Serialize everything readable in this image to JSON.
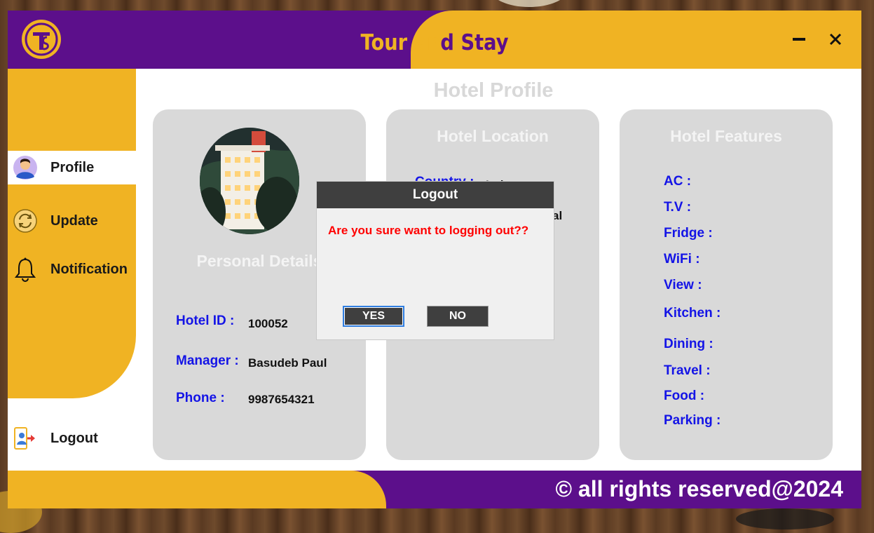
{
  "app": {
    "title_part1": "Tour an",
    "title_part2": "d Stay",
    "footer": "© all rights reserved@2024"
  },
  "window_controls": {
    "minimize": "–",
    "close": "✕"
  },
  "sidebar": {
    "items": [
      {
        "label": "Profile",
        "icon": "user-avatar-icon",
        "active": true
      },
      {
        "label": "Update",
        "icon": "refresh-icon"
      },
      {
        "label": "Notification",
        "icon": "bell-icon"
      }
    ],
    "logout": {
      "label": "Logout",
      "icon": "logout-icon"
    }
  },
  "main": {
    "page_title": "Hotel Profile",
    "personal": {
      "title": "Personal Details",
      "hotel_id_label": "Hotel ID :",
      "hotel_id": "100052",
      "manager_label": "Manager :",
      "manager": "Basudeb Paul",
      "phone_label": "Phone :",
      "phone": "9987654321"
    },
    "location": {
      "title": "Hotel Location",
      "country_label": "Country :",
      "country_value_partial": "Ind",
      "second_value_partial": "al"
    },
    "features": {
      "title": "Hotel Features",
      "items": [
        "AC :",
        "T.V :",
        "Fridge :",
        "WiFi :",
        "View :",
        "Kitchen :",
        "Dining :",
        "Travel :",
        "Food :",
        "Parking :"
      ]
    }
  },
  "dialog": {
    "title": "Logout",
    "message": "Are you sure want to logging out??",
    "yes": "YES",
    "no": "NO"
  },
  "colors": {
    "purple": "#5c0f8b",
    "yellow": "#f0b323",
    "label_blue": "#1414e6",
    "warning_red": "#ff0000"
  }
}
